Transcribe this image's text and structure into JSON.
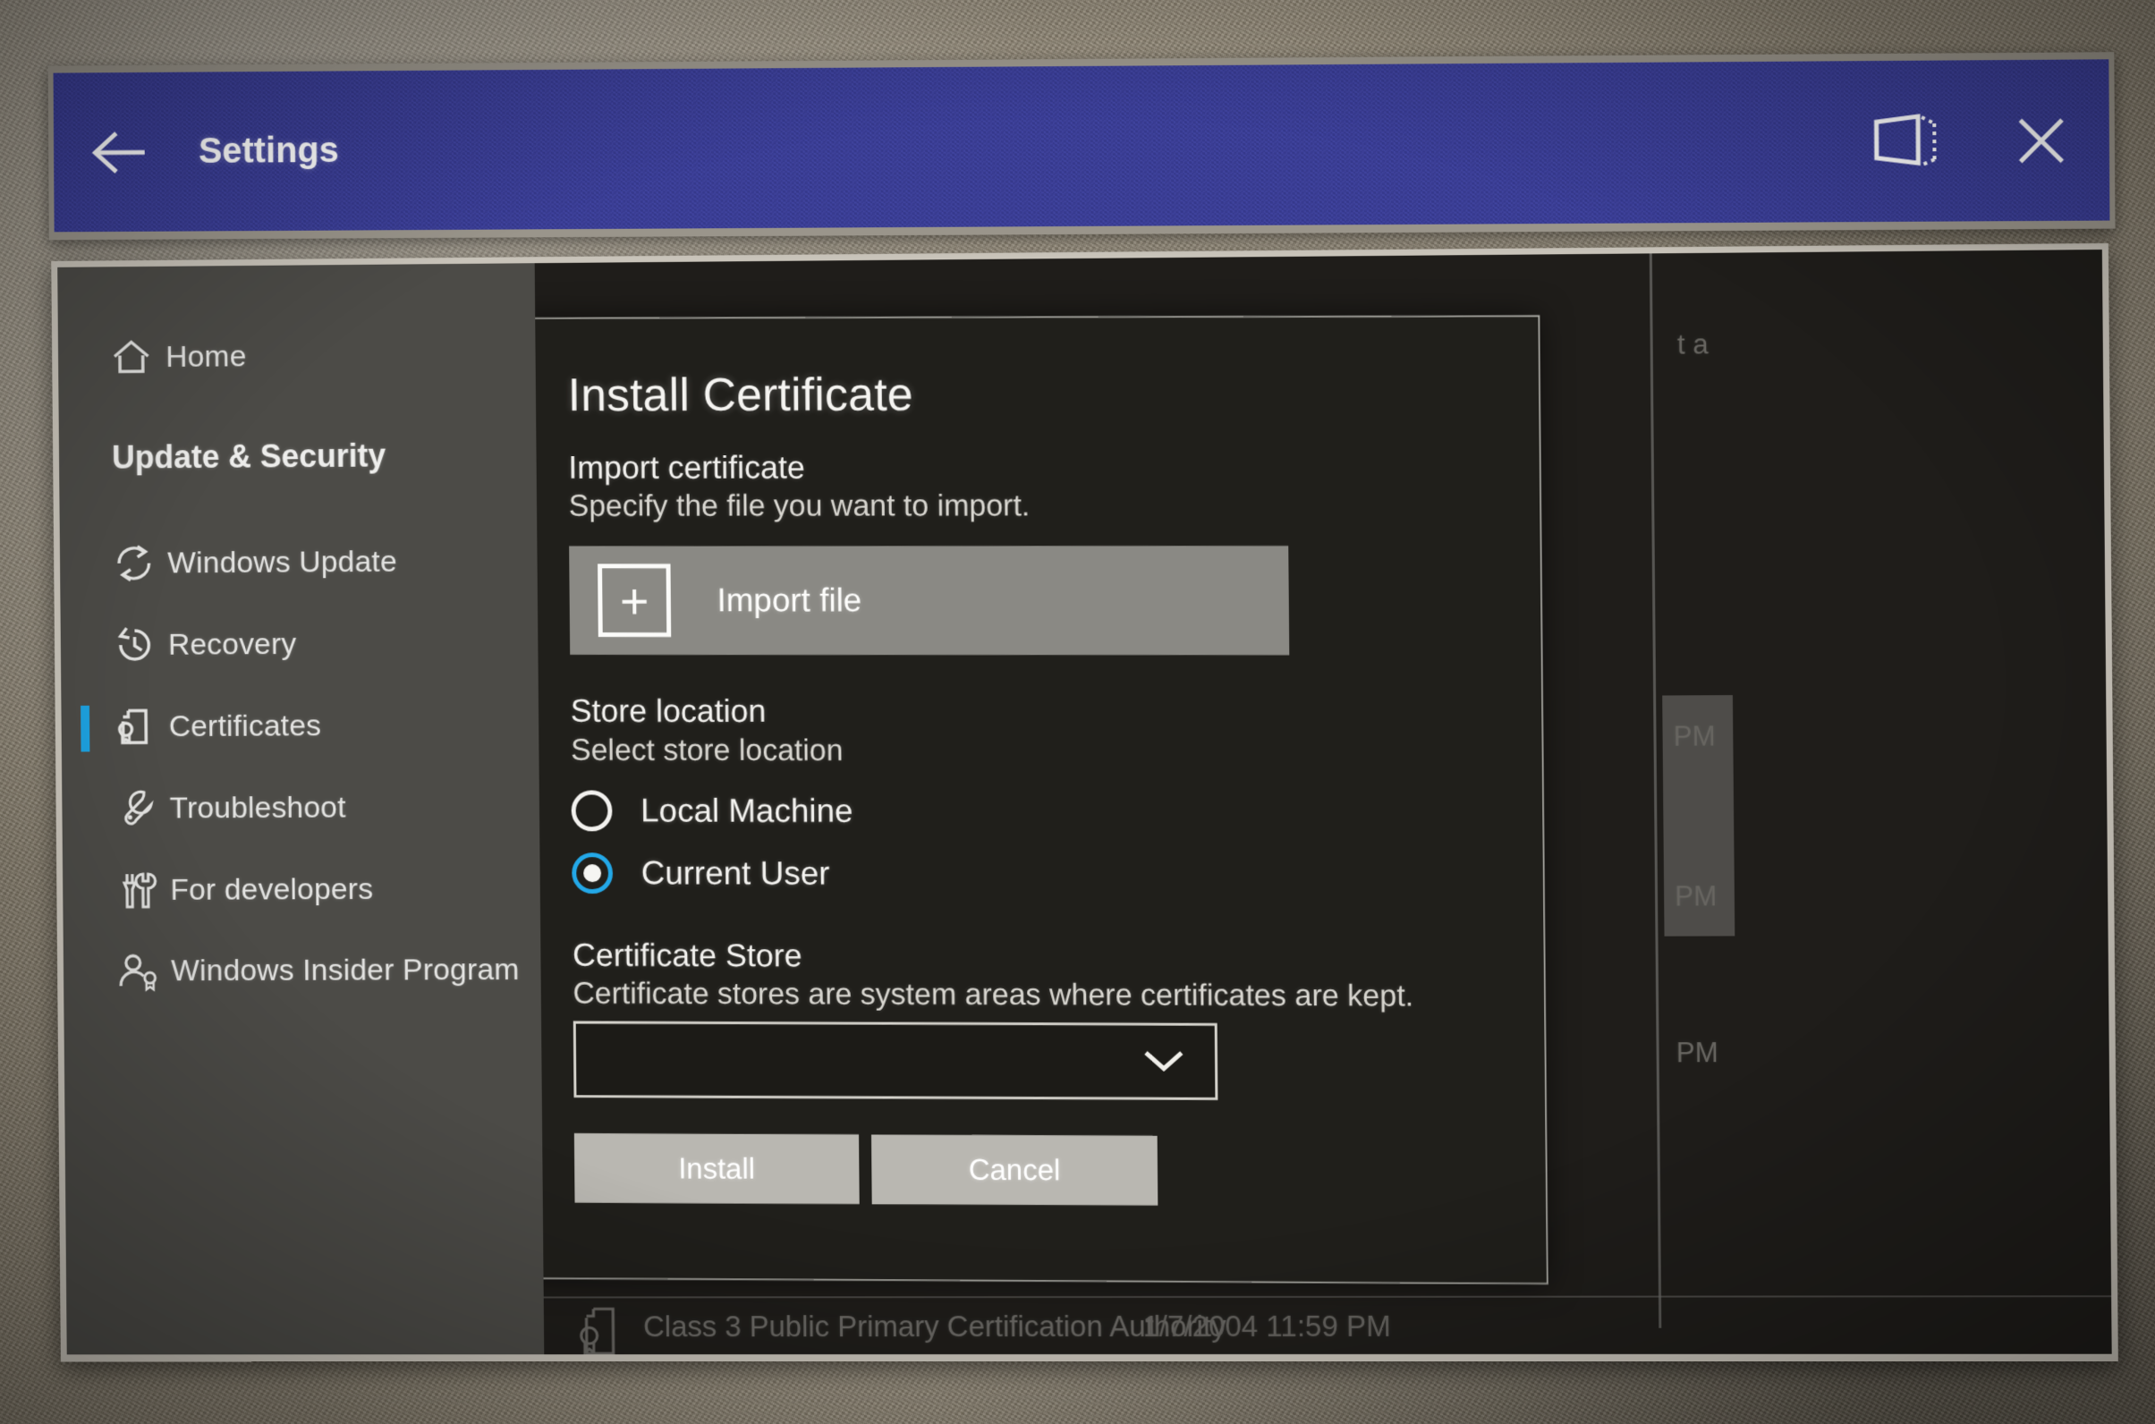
{
  "titlebar": {
    "back_icon": "back-arrow-icon",
    "title": "Settings",
    "follow_icon": "follow-me-icon",
    "close_icon": "close-icon"
  },
  "sidebar": {
    "home": {
      "label": "Home",
      "icon": "home-icon"
    },
    "header": "Update & Security",
    "items": [
      {
        "label": "Windows Update",
        "icon": "sync-icon",
        "selected": false
      },
      {
        "label": "Recovery",
        "icon": "history-icon",
        "selected": false
      },
      {
        "label": "Certificates",
        "icon": "certificate-icon",
        "selected": true
      },
      {
        "label": "Troubleshoot",
        "icon": "wrench-icon",
        "selected": false
      },
      {
        "label": "For developers",
        "icon": "tools-icon",
        "selected": false
      },
      {
        "label": "Windows Insider Program",
        "icon": "insider-icon",
        "selected": false
      }
    ]
  },
  "background": {
    "fragment_text": "t a",
    "time_labels": [
      "PM",
      "PM",
      "PM"
    ],
    "row": {
      "name": "Class 3 Public Primary Certification Authority",
      "date": "1/7/2004 11:59 PM",
      "icon": "certificate-icon"
    }
  },
  "dialog": {
    "title": "Install Certificate",
    "import": {
      "heading": "Import certificate",
      "subtext": "Specify the file you want to import.",
      "button_label": "Import file",
      "button_icon": "plus-icon"
    },
    "store_location": {
      "heading": "Store location",
      "subtext": "Select store location",
      "options": [
        {
          "label": "Local Machine",
          "selected": false
        },
        {
          "label": "Current User",
          "selected": true
        }
      ]
    },
    "certificate_store": {
      "heading": "Certificate Store",
      "subtext": "Certificate stores are system areas where certificates are kept.",
      "select_value": "",
      "select_placeholder": "",
      "chevron_icon": "chevron-down-icon"
    },
    "actions": {
      "install_label": "Install",
      "cancel_label": "Cancel"
    }
  },
  "colors": {
    "titlebar": "#3b3e96",
    "accent": "#1ea2e0",
    "radio_accent": "#23a8e8",
    "sidebar": "#4c4b47",
    "content": "#35342f",
    "button": "#b9b7b1"
  }
}
